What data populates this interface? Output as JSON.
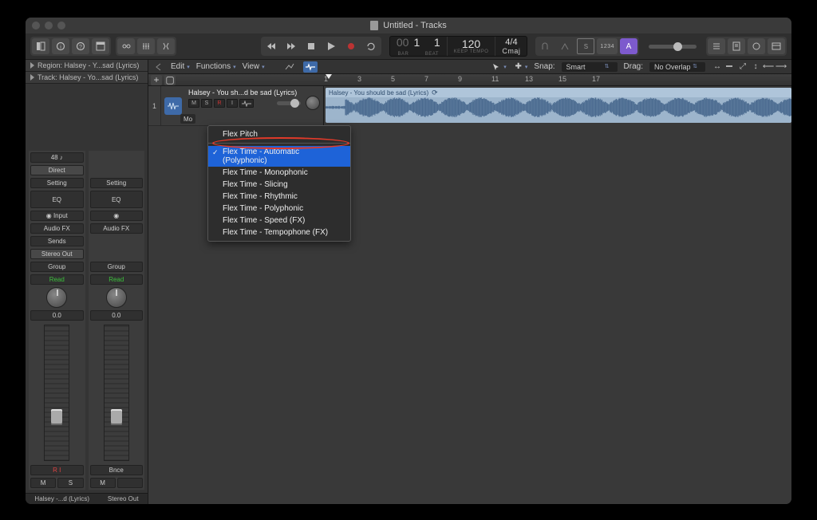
{
  "window_title": "Untitled - Tracks",
  "info_bars": {
    "region": "Region: Halsey - Y...sad (Lyrics)",
    "track": "Track:  Halsey - Yo...sad (Lyrics)"
  },
  "lcd": {
    "bar_dim": "00",
    "bar": "1",
    "bar_label": "BAR",
    "beat": "1",
    "beat_label": "BEAT",
    "tempo": "120",
    "tempo_label": "KEEP TEMPO",
    "sig": "4/4",
    "key": "Cmaj"
  },
  "toolbar_buttons": {
    "library": "library",
    "inspector": "inspector",
    "quickhelp": "quickhelp",
    "toolbar_custom": "toolbar",
    "smart_controls": "smart",
    "mixer": "mixer",
    "scissors": "scissors"
  },
  "toolbar_right": {
    "count_btn": "1234",
    "tuning_btn": "A"
  },
  "track_menus": {
    "edit": "Edit",
    "functions": "Functions",
    "view": "View"
  },
  "snap": {
    "label": "Snap:",
    "value": "Smart"
  },
  "drag": {
    "label": "Drag:",
    "value": "No Overlap"
  },
  "ruler_numbers": [
    "1",
    "3",
    "5",
    "7",
    "9",
    "11",
    "13",
    "15",
    "17"
  ],
  "track": {
    "index": "1",
    "name": "Halsey - You sh...d be sad (Lyrics)",
    "buttons": {
      "m": "M",
      "s": "S",
      "r": "R",
      "i": "I"
    },
    "mode_prefix": "Mo"
  },
  "region_title": "Halsey - You should be sad (Lyrics)",
  "flex_menu": {
    "pitch": "Flex Pitch",
    "items": [
      "Flex Time - Automatic (Polyphonic)",
      "Flex Time - Monophonic",
      "Flex Time - Slicing",
      "Flex Time - Rhythmic",
      "Flex Time - Polyphonic",
      "Flex Time - Speed (FX)",
      "Flex Time - Tempophone (FX)"
    ],
    "selected_index": 0
  },
  "inspector": {
    "channel1": {
      "gain": "48  ♪",
      "direct": "Direct",
      "setting": "Setting",
      "eq": "EQ",
      "rec": "◉  Input",
      "audiofx": "Audio FX",
      "sends": "Sends",
      "stereo_out": "Stereo Out",
      "group": "Group",
      "read": "Read",
      "pan_value": "0.0",
      "rec_indicator": "R  I",
      "ms": {
        "m": "M",
        "s": "S"
      },
      "foot": "Halsey -...d (Lyrics)"
    },
    "channel2": {
      "setting": "Setting",
      "eq": "EQ",
      "rec_icon": "◉",
      "audiofx": "Audio FX",
      "group": "Group",
      "read": "Read",
      "pan_value": "0.0",
      "bnce": "Bnce",
      "m": "M",
      "foot": "Stereo Out"
    }
  }
}
